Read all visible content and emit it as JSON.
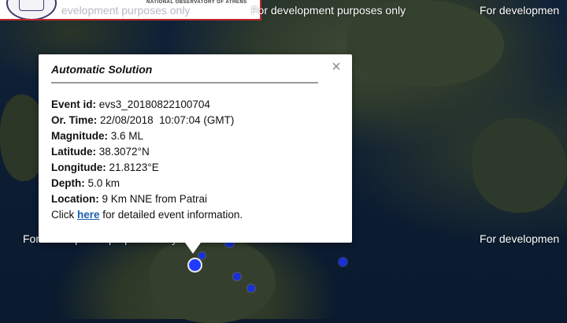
{
  "banner": {
    "org_name": "NATIONAL OBSERVATORY OF ATHENS",
    "overlay_text": "evelopment purposes only"
  },
  "watermarks": [
    "For development purposes only",
    "For developmen",
    "For development purposes only",
    "For developmen"
  ],
  "popup": {
    "title": "Automatic Solution",
    "close_glyph": "×",
    "event_id_label": "Event id:",
    "event_id": "evs3_20180822100704",
    "or_time_label": "Or. Time:",
    "or_time": "22/08/2018  10:07:04 (GMT)",
    "magnitude_label": "Magnitude:",
    "magnitude": "3.6 ML",
    "latitude_label": "Latitude:",
    "latitude": "38.3072°N",
    "longitude_label": "Longitude:",
    "longitude": "21.8123°E",
    "depth_label": "Depth:",
    "depth": "5.0 km",
    "location_label": "Location:",
    "location": "9 Km NNE from Patrai",
    "click_prefix": "Click ",
    "link_text": "here",
    "click_suffix": " for detailed event information."
  },
  "colors": {
    "event_marker": "#1a2fd8",
    "link": "#1a5fb4",
    "banner_border": "#c0282d"
  }
}
